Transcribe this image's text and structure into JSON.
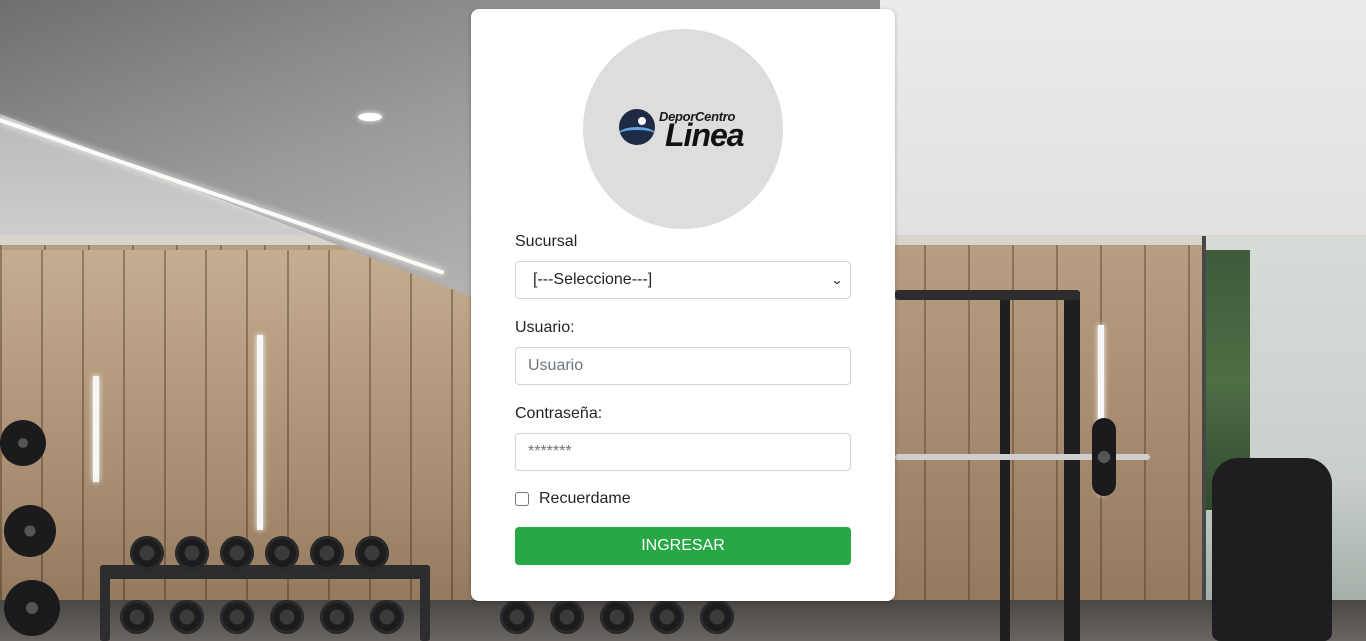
{
  "logo": {
    "top_text": "DeporCentro",
    "bottom_text": "Linea",
    "icon": "wave-logo-icon"
  },
  "form": {
    "branch_label": "Sucursal",
    "branch_selected": "[---Seleccione---]",
    "user_label": "Usuario:",
    "user_placeholder": "Usuario",
    "user_value": "",
    "password_label": "Contraseña:",
    "password_placeholder": "*******",
    "password_value": "",
    "remember_label": "Recuerdame",
    "remember_checked": false,
    "submit_label": "INGRESAR"
  },
  "colors": {
    "accent": "#28a745",
    "card": "#ffffff",
    "logo_bg": "#dddddd"
  }
}
